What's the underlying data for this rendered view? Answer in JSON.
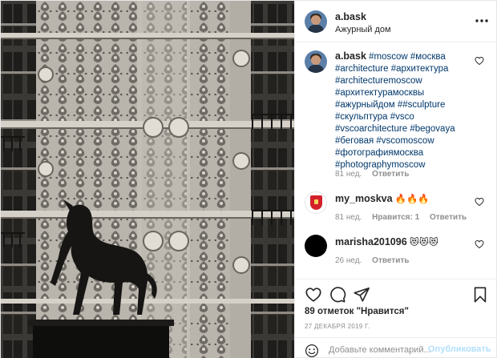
{
  "post": {
    "author": "a.bask",
    "location": "Ажурный дом"
  },
  "caption": {
    "author": "a.bask",
    "hashtags": [
      "#moscow",
      "#москва",
      "#architecture",
      "#архитектура",
      "#architecturemoscow",
      "#архитектурамосквы",
      "#ажурныйдом",
      "##sculpture",
      "#скульптура",
      "#vsco",
      "#vscoarchitecture",
      "#begovaya",
      "#беговая",
      "#vscomoscow",
      "#фотографиямосква",
      "#photographymoscow"
    ],
    "age": "81 нед.",
    "reply_label": "Ответить"
  },
  "comments": [
    {
      "author": "my_moskva",
      "text": "🔥🔥🔥",
      "age": "81 нед.",
      "likes_label": "Нравится: 1",
      "reply_label": "Ответить"
    },
    {
      "author": "marisha201096",
      "text": "😻😻😻",
      "age": "26 нед.",
      "reply_label": "Ответить"
    }
  ],
  "footer": {
    "likes": "89 отметок \"Нравится\"",
    "date": "27 декабря 2019 г.",
    "comment_placeholder": "Добавьте комментарий...",
    "publish_label": "Опубликовать"
  },
  "icons": {
    "more": "more-horizontal-icon",
    "like": "heart-icon",
    "comment": "comment-icon",
    "share": "paper-plane-icon",
    "save": "bookmark-icon",
    "emoji": "smiley-icon"
  },
  "colors": {
    "hashtag": "#00376b",
    "meta": "#8e8e8e",
    "publish": "#b2dffc",
    "border": "#efefef"
  }
}
